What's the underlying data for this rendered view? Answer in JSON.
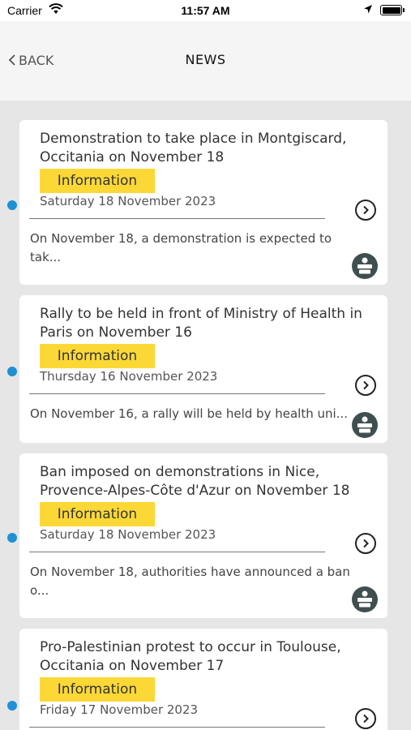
{
  "status_bar": {
    "carrier": "Carrier",
    "time": "11:57 AM"
  },
  "nav": {
    "back_label": "BACK",
    "title": "NEWS"
  },
  "colors": {
    "badge": "#fcd837",
    "unread_dot": "#1e90d6",
    "category_icon": "#3f4f4f"
  },
  "news": [
    {
      "title": "Demonstration to take place in Montgiscard, Occitania on November 18",
      "badge": "Information",
      "date": "Saturday 18 November 2023",
      "summary": "On November 18, a demonstration is expected to tak..."
    },
    {
      "title": "Rally to be held in front of Ministry of Health in Paris on November 16",
      "badge": "Information",
      "date": "Thursday 16 November 2023",
      "summary": "On November 16, a rally will be held by health uni..."
    },
    {
      "title": "Ban imposed on demonstrations in Nice, Provence-Alpes-Côte d'Azur on November 18",
      "badge": "Information",
      "date": "Saturday 18 November 2023",
      "summary": "On November 18, authorities have announced a ban o..."
    },
    {
      "title": "Pro-Palestinian protest to occur in Toulouse, Occitania on November 17",
      "badge": "Information",
      "date": "Friday 17 November 2023",
      "summary": ""
    }
  ]
}
